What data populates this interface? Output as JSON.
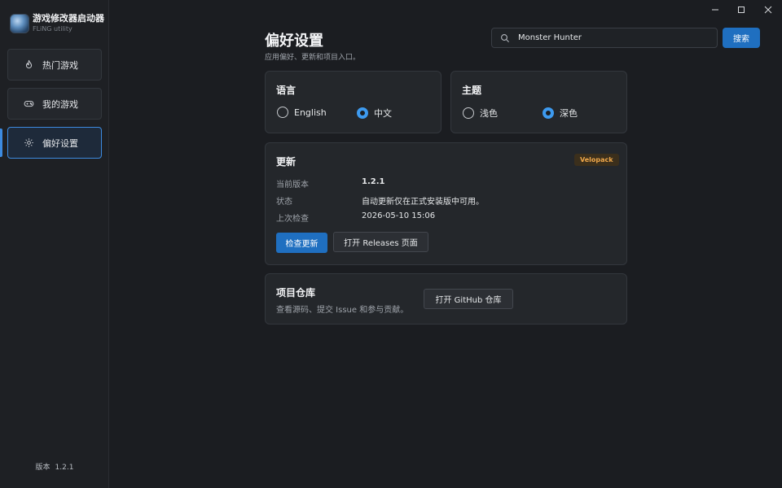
{
  "app": {
    "title": "游戏修改器启动器",
    "subtitle": "FLiNG utility"
  },
  "sidebar": {
    "items": [
      {
        "label": "热门游戏",
        "icon": "flame-icon"
      },
      {
        "label": "我的游戏",
        "icon": "gamepad-icon"
      },
      {
        "label": "偏好设置",
        "icon": "gear-icon",
        "active": true
      }
    ],
    "version_label": "版本",
    "version": "1.2.1"
  },
  "header": {
    "title": "偏好设置",
    "subtitle": "应用偏好、更新和项目入口。",
    "search_value": "Monster Hunter",
    "search_button": "搜索"
  },
  "language": {
    "title": "语言",
    "options": [
      {
        "label": "English",
        "selected": false
      },
      {
        "label": "中文",
        "selected": true
      }
    ]
  },
  "theme": {
    "title": "主题",
    "options": [
      {
        "label": "浅色",
        "selected": false
      },
      {
        "label": "深色",
        "selected": true
      }
    ]
  },
  "update": {
    "title": "更新",
    "badge": "Velopack",
    "rows": [
      {
        "label": "当前版本",
        "value": "1.2.1"
      },
      {
        "label": "状态",
        "value": "自动更新仅在正式安装版中可用。"
      },
      {
        "label": "上次检查",
        "value": "2026-05-10 15:06"
      }
    ],
    "check_button": "检查更新",
    "releases_button": "打开 Releases 页面"
  },
  "repo": {
    "title": "项目仓库",
    "desc": "查看源码、提交 Issue 和参与贡献。",
    "button": "打开 GitHub 仓库"
  },
  "colors": {
    "accent": "#1f6fc0",
    "radio_selected": "#3d9aef",
    "badge_text": "#f0a84a",
    "background": "#1b1d21"
  }
}
